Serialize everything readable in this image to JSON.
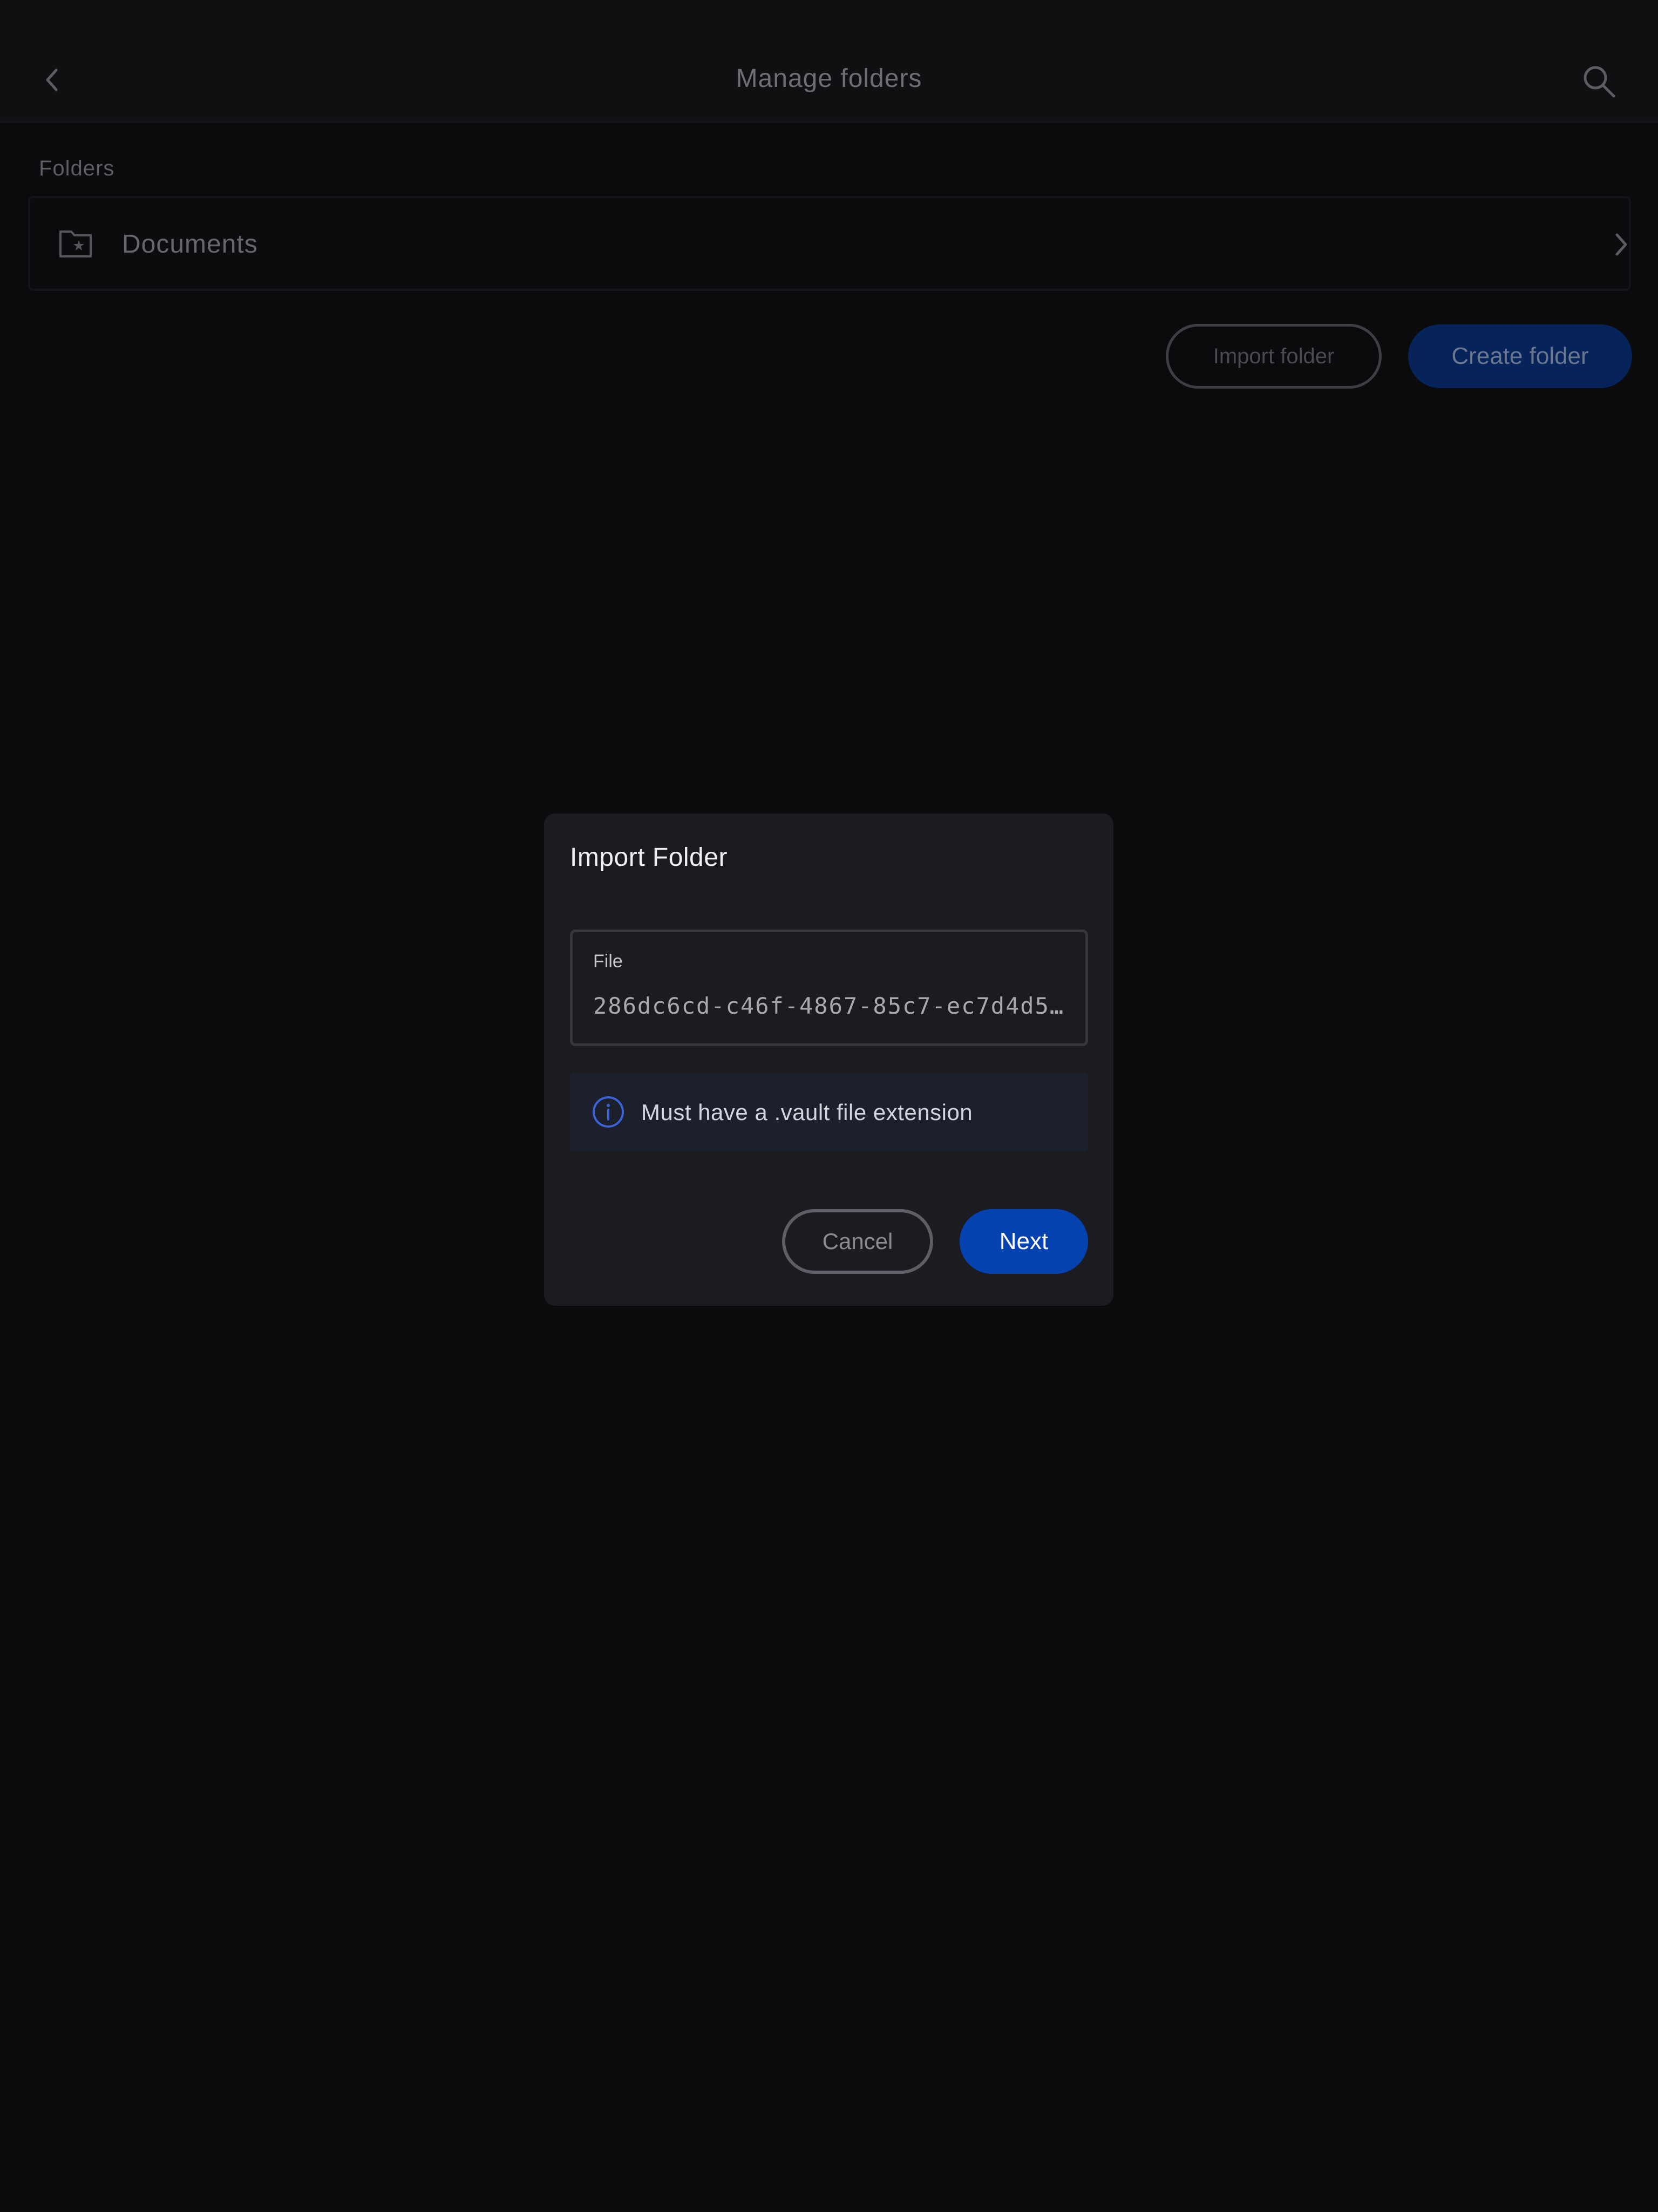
{
  "header": {
    "title": "Manage folders",
    "back_icon": "chevron-left-icon",
    "search_icon": "search-icon"
  },
  "folders": {
    "section_label": "Folders",
    "items": [
      {
        "name": "Documents",
        "icon": "folder-star-icon"
      }
    ]
  },
  "actions": {
    "import_label": "Import folder",
    "create_label": "Create folder"
  },
  "dialog": {
    "title": "Import Folder",
    "file_label": "File",
    "file_value": "286dc6cd-c46f-4867-85c7-ec7d4d56…",
    "info_text": "Must have a .vault file extension",
    "cancel_label": "Cancel",
    "next_label": "Next"
  },
  "colors": {
    "background": "#0b0b0d",
    "dialog": "#1c1b20",
    "accent": "#0442b0",
    "info_icon": "#3b63d6"
  }
}
